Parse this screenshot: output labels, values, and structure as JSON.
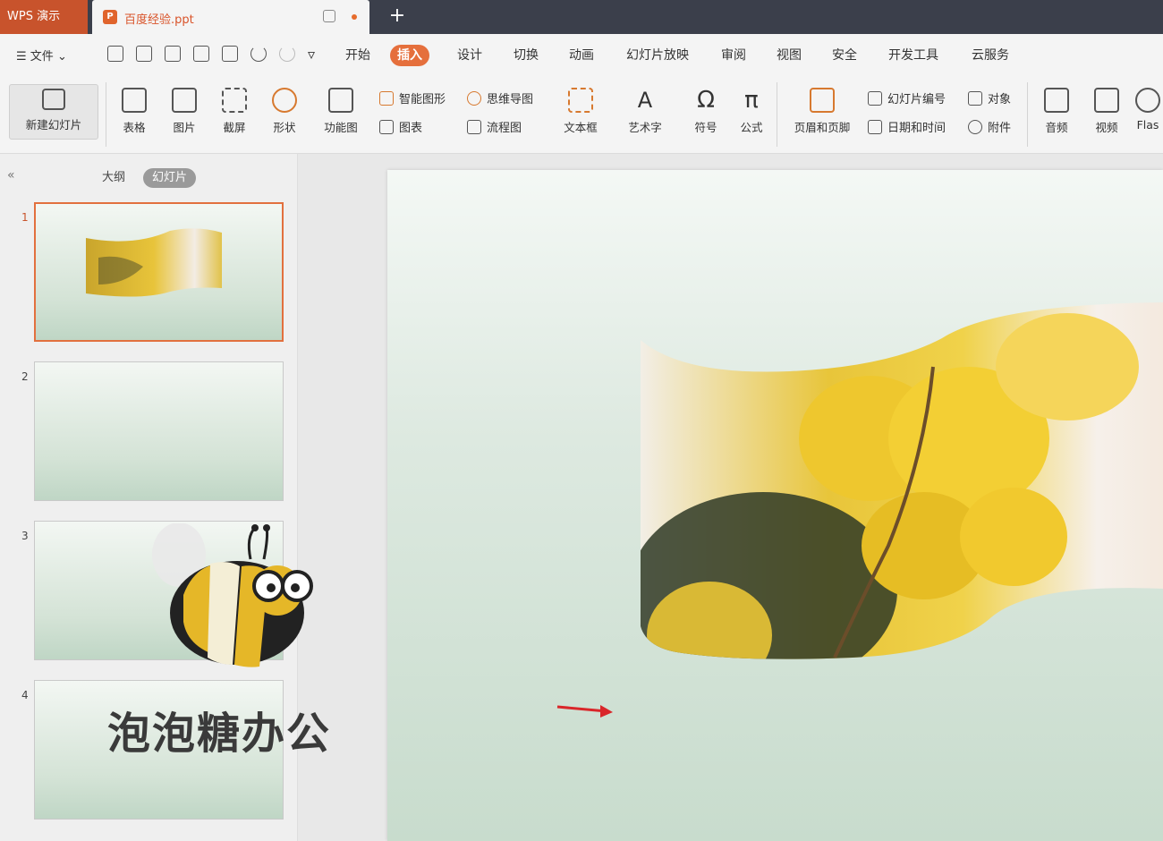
{
  "titlebar": {
    "app_tab": "WPS 演示",
    "doc_tab": "百度经验.ppt",
    "doc_icon_letter": "P"
  },
  "menubar": {
    "file_label": "文件",
    "items": [
      "开始",
      "插入",
      "设计",
      "切换",
      "动画",
      "幻灯片放映",
      "审阅",
      "视图",
      "安全",
      "开发工具",
      "云服务"
    ],
    "active": "插入"
  },
  "ribbon": {
    "new_slide": "新建幻灯片",
    "table": "表格",
    "picture": "图片",
    "screenshot": "截屏",
    "shape": "形状",
    "function_chart": "功能图",
    "smart_art": "智能图形",
    "chart": "图表",
    "mind_map": "思维导图",
    "flow_chart": "流程图",
    "text_box": "文本框",
    "word_art": "艺术字",
    "symbol": "符号",
    "formula": "公式",
    "header_footer": "页眉和页脚",
    "slide_number": "幻灯片编号",
    "date_time": "日期和时间",
    "object": "对象",
    "attachment": "附件",
    "audio": "音频",
    "video": "视频",
    "flash": "Flas"
  },
  "leftpane": {
    "outline_tab": "大纲",
    "slides_tab": "幻灯片",
    "thumbnails": [
      "1",
      "2",
      "3",
      "4"
    ]
  },
  "watermark": "泡泡糖办公",
  "colors": {
    "accent": "#e56f3c",
    "titlebar": "#3b3f4b",
    "wps_tab": "#c8532c",
    "arrow": "#d9262a"
  }
}
